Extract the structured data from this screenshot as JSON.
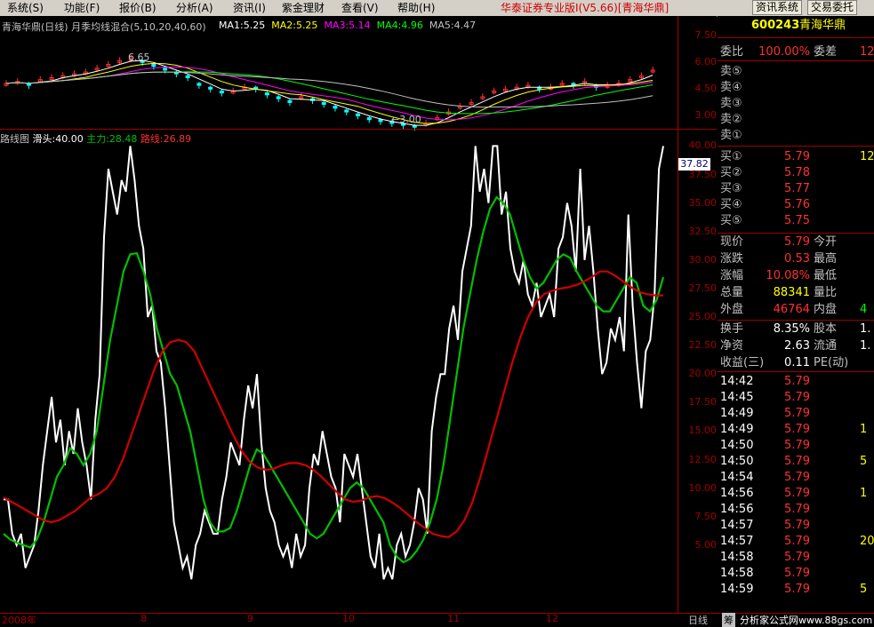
{
  "menu": {
    "items": [
      "系统(S)",
      "功能(F)",
      "报价(B)",
      "分析(A)",
      "资讯(I)",
      "紫金理财",
      "查看(V)",
      "帮助(H)"
    ],
    "app_title": "华泰证券专业版I(V5.66)[青海华鼎]",
    "btn_news": "资讯系统",
    "btn_trade": "交易委托"
  },
  "kline": {
    "title": "青海华鼎(日线) 月季均线混合(5,10,20,40,60)",
    "ma": [
      {
        "label": "MA1:5.25",
        "color": "#ffffff"
      },
      {
        "label": "MA2:5.25",
        "color": "#ffff00"
      },
      {
        "label": "MA3:5.14",
        "color": "#ff00ff"
      },
      {
        "label": "MA4:4.96",
        "color": "#00ff00"
      },
      {
        "label": "MA5:4.47",
        "color": "#c0c0c0"
      }
    ],
    "high_label": "6.65",
    "low_label": "←3.00",
    "y_ticks": [
      "7.50",
      "6.00",
      "4.50",
      "3.00"
    ]
  },
  "indicator": {
    "name": "路线图",
    "slip_label": "滑头:40.00",
    "main_label": "主力:28.48",
    "route_label": "路线:26.89",
    "current_value": "37.82",
    "y_ticks": [
      "40.00",
      "37.50",
      "35.00",
      "32.50",
      "30.00",
      "27.50",
      "25.00",
      "22.50",
      "20.00",
      "17.50",
      "15.00",
      "12.50",
      "10.00",
      "7.50",
      "5.00"
    ],
    "colors": {
      "slip": "#ffffff",
      "main": "#00c000",
      "route": "#d00000"
    }
  },
  "chart_data": {
    "type": "line",
    "title": "",
    "ylim": [
      0,
      40.5
    ],
    "x": [
      1,
      2,
      3,
      4,
      5,
      6,
      7,
      8,
      9,
      10,
      11,
      12,
      13,
      14,
      15,
      16,
      17,
      18,
      19,
      20,
      21,
      22,
      23,
      24,
      25,
      26,
      27,
      28,
      29,
      30,
      31,
      32,
      33,
      34,
      35,
      36,
      37,
      38,
      39,
      40,
      41,
      42,
      43,
      44,
      45,
      46,
      47,
      48,
      49,
      50,
      51,
      52,
      53,
      54,
      55,
      56,
      57,
      58,
      59,
      60,
      61,
      62,
      63,
      64,
      65,
      66,
      67,
      68,
      69,
      70,
      71,
      72,
      73,
      74,
      75,
      76,
      77,
      78,
      79,
      80,
      81,
      82,
      83,
      84,
      85,
      86,
      87,
      88,
      89,
      90,
      91,
      92,
      93,
      94,
      95,
      96,
      97,
      98,
      99,
      100,
      101,
      102,
      103,
      104,
      105,
      106,
      107,
      108,
      109,
      110,
      111,
      112,
      113,
      114,
      115,
      116,
      117,
      118,
      119,
      120,
      121,
      122,
      123,
      124,
      125,
      126,
      127,
      128,
      129,
      130,
      131,
      132,
      133,
      134,
      135,
      136,
      137,
      138,
      139,
      140,
      141,
      142,
      143,
      144,
      145,
      146,
      147
    ],
    "series": [
      {
        "name": "滑头",
        "values": [
          9,
          9,
          6,
          5,
          6,
          3,
          4,
          5,
          8,
          12,
          15,
          18,
          14,
          16,
          12,
          15,
          13,
          17,
          14,
          12,
          9,
          16,
          20,
          32,
          38,
          36,
          34,
          37,
          36,
          40,
          37,
          33,
          31,
          25,
          26,
          22,
          21,
          17,
          12,
          7,
          5,
          3,
          4,
          2,
          5,
          6,
          8,
          7,
          6,
          6,
          9,
          11,
          14,
          13,
          12,
          16,
          19,
          17,
          20,
          14,
          10,
          8,
          7,
          5,
          4,
          5,
          3,
          6,
          4,
          5,
          10,
          13,
          12,
          15,
          13,
          11,
          10,
          7,
          13,
          12,
          11,
          13,
          10,
          7,
          4,
          3,
          6,
          2,
          3,
          2,
          5,
          6,
          4,
          5,
          7,
          10,
          9,
          6,
          15,
          18,
          20,
          20,
          24,
          26,
          23,
          29,
          31,
          33,
          40,
          36,
          38,
          35,
          40,
          40,
          34,
          36,
          31,
          29,
          28,
          30,
          27,
          26,
          28,
          25,
          26,
          27,
          25,
          31,
          32,
          35,
          33,
          29,
          38,
          30,
          33,
          29,
          24,
          20,
          21,
          24,
          23,
          25,
          22,
          34,
          26,
          21,
          17,
          22,
          23,
          27,
          38,
          40
        ]
      },
      {
        "name": "主力",
        "values": [
          6,
          5.5,
          5.2,
          5,
          4.8,
          5.5,
          7,
          9,
          11,
          12,
          13.5,
          13,
          12,
          13,
          15,
          19,
          23,
          26,
          29,
          30.5,
          30.6,
          29,
          27,
          24,
          22,
          20,
          19,
          17,
          15,
          12,
          9,
          7,
          6.2,
          6.2,
          6.5,
          8,
          10,
          12,
          13.4,
          13,
          12,
          11,
          10,
          9,
          8,
          7,
          6,
          5.6,
          6,
          7,
          8,
          9,
          10,
          10.5,
          10,
          9,
          8,
          7,
          5,
          4,
          3.5,
          3.8,
          4.5,
          5.5,
          7,
          9,
          12,
          16,
          20,
          24,
          27,
          30,
          32.5,
          34.5,
          35.5,
          35,
          34,
          32,
          30,
          28.5,
          27.5,
          28,
          29,
          30,
          30.5,
          30.2,
          29,
          28,
          27,
          26,
          25.5,
          25.5,
          26.5,
          27.5,
          28.5,
          28,
          26,
          25.5,
          26.5,
          28.5
        ]
      },
      {
        "name": "路线",
        "values": [
          9.2,
          8.8,
          8.4,
          8,
          7.6,
          7.2,
          7,
          7.2,
          7.6,
          8,
          8.6,
          9.2,
          9.5,
          10,
          11,
          12.5,
          14.5,
          16.5,
          18.5,
          20.5,
          22,
          22.8,
          23,
          22.8,
          22,
          20.5,
          19,
          17.5,
          16,
          14.5,
          13.2,
          12.3,
          11.8,
          11.6,
          11.7,
          12,
          12.2,
          12.2,
          12,
          11.6,
          11,
          10.3,
          9.6,
          9,
          8.8,
          8.9,
          9.2,
          9.3,
          9.1,
          8.7,
          8.2,
          7.6,
          7,
          6.5,
          6,
          5.8,
          5.7,
          6.2,
          7.2,
          8.8,
          11,
          13.5,
          16,
          18.5,
          21,
          23.2,
          25,
          26.3,
          27,
          27.3,
          27.5,
          27.6,
          27.8,
          28.1,
          28.5,
          29,
          29,
          28.6,
          28.1,
          27.6,
          27.2,
          27,
          26.9,
          26.9
        ]
      }
    ]
  },
  "bottom": {
    "year": "2008年",
    "months": [
      "8",
      "9",
      "10",
      "11",
      "12"
    ],
    "period": "日线",
    "tab": "筹",
    "watermark": "分析家公式网www.88gs.com"
  },
  "quote": {
    "code": "600243",
    "name": "青海华鼎",
    "weibi_label": "委比",
    "weibi_value": "100.00%",
    "weicha_label": "委差",
    "weicha_value": "12",
    "asks": [
      {
        "label": "卖⑤",
        "price": "",
        "vol": ""
      },
      {
        "label": "卖④",
        "price": "",
        "vol": ""
      },
      {
        "label": "卖③",
        "price": "",
        "vol": ""
      },
      {
        "label": "卖②",
        "price": "",
        "vol": ""
      },
      {
        "label": "卖①",
        "price": "",
        "vol": ""
      }
    ],
    "bids": [
      {
        "label": "买①",
        "price": "5.79",
        "vol": "12"
      },
      {
        "label": "买②",
        "price": "5.78",
        "vol": ""
      },
      {
        "label": "买③",
        "price": "5.77",
        "vol": ""
      },
      {
        "label": "买④",
        "price": "5.76",
        "vol": ""
      },
      {
        "label": "买⑤",
        "price": "5.75",
        "vol": ""
      }
    ],
    "stats": [
      {
        "l1": "现价",
        "v1": "5.79",
        "c1": "red",
        "l2": "今开",
        "v2": ""
      },
      {
        "l1": "涨跌",
        "v1": "0.53",
        "c1": "red",
        "l2": "最高",
        "v2": ""
      },
      {
        "l1": "涨幅",
        "v1": "10.08%",
        "c1": "red",
        "l2": "最低",
        "v2": ""
      },
      {
        "l1": "总量",
        "v1": "88341",
        "c1": "yellow",
        "l2": "量比",
        "v2": ""
      },
      {
        "l1": "外盘",
        "v1": "46764",
        "c1": "red",
        "l2": "内盘",
        "v2": "4"
      }
    ],
    "stats2": [
      {
        "l1": "换手",
        "v1": "8.35%",
        "l2": "股本",
        "v2": "1."
      },
      {
        "l1": "净资",
        "v1": "2.63",
        "l2": "流通",
        "v2": "1."
      },
      {
        "l1": "收益(三)",
        "v1": "0.11",
        "l2": "PE(动)",
        "v2": ""
      }
    ],
    "ticks": [
      {
        "time": "14:42",
        "price": "5.79",
        "vol": ""
      },
      {
        "time": "14:45",
        "price": "5.79",
        "vol": ""
      },
      {
        "time": "14:49",
        "price": "5.79",
        "vol": ""
      },
      {
        "time": "14:49",
        "price": "5.79",
        "vol": "1"
      },
      {
        "time": "14:50",
        "price": "5.79",
        "vol": ""
      },
      {
        "time": "14:50",
        "price": "5.79",
        "vol": "5"
      },
      {
        "time": "14:54",
        "price": "5.79",
        "vol": ""
      },
      {
        "time": "14:56",
        "price": "5.79",
        "vol": "1"
      },
      {
        "time": "14:56",
        "price": "5.79",
        "vol": ""
      },
      {
        "time": "14:57",
        "price": "5.79",
        "vol": ""
      },
      {
        "time": "14:57",
        "price": "5.79",
        "vol": "20"
      },
      {
        "time": "14:58",
        "price": "5.79",
        "vol": ""
      },
      {
        "time": "14:58",
        "price": "5.79",
        "vol": ""
      },
      {
        "time": "14:59",
        "price": "5.79",
        "vol": "5"
      }
    ]
  }
}
